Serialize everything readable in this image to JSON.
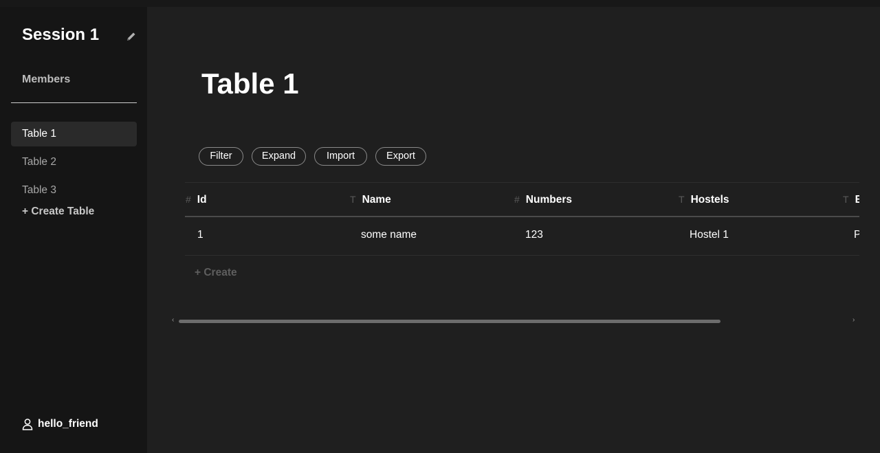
{
  "sidebar": {
    "session_title": "Session 1",
    "edit_icon": "pencil-icon",
    "members_label": "Members",
    "tables": [
      {
        "label": "Table 1",
        "active": true
      },
      {
        "label": "Table 2",
        "active": false
      },
      {
        "label": "Table 3",
        "active": false
      }
    ],
    "create_table_label": "+ Create Table",
    "user": {
      "icon": "user-icon",
      "name": "hello_friend"
    }
  },
  "main": {
    "title": "Table 1",
    "toolbar": {
      "filter_label": "Filter",
      "expand_label": "Expand",
      "import_label": "Import",
      "export_label": "Export"
    },
    "table": {
      "columns": [
        {
          "type_icon": "#",
          "label": "Id"
        },
        {
          "type_icon": "T",
          "label": "Name"
        },
        {
          "type_icon": "#",
          "label": "Numbers"
        },
        {
          "type_icon": "T",
          "label": "Hostels"
        },
        {
          "type_icon": "T",
          "label": "E"
        }
      ],
      "rows": [
        [
          "1",
          "some name",
          "123",
          "Hostel 1",
          "P"
        ]
      ]
    },
    "create_row_label": "+ Create",
    "scrollbar": {
      "left_arrow": "‹",
      "right_arrow": "›"
    }
  },
  "colors": {
    "background": "#1f1f1f",
    "sidebar": "#151515",
    "active_item": "#2a2a2a",
    "text": "#ffffff",
    "muted": "#a8a8a8"
  }
}
